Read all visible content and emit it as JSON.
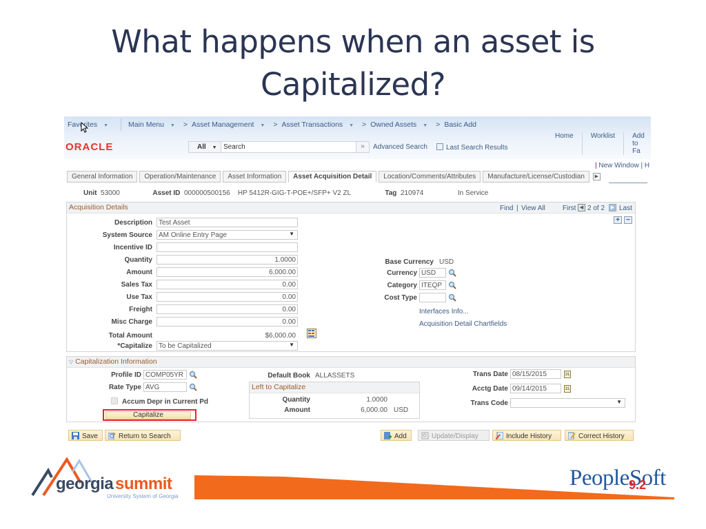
{
  "slide": {
    "title_line1": "What happens when an asset is",
    "title_line2": "Capitalized?"
  },
  "nav": {
    "favorites": "Favorites",
    "main_menu": "Main Menu",
    "breadcrumb": [
      "Asset Management",
      "Asset Transactions",
      "Owned Assets",
      "Basic Add"
    ],
    "sep": ">"
  },
  "header": {
    "logo": "ORACLE",
    "search_scope": "All",
    "search_placeholder": "Search",
    "search_go": "»",
    "advanced_search": "Advanced Search",
    "last_search_results": "Last Search Results",
    "links": [
      "Home",
      "Worklist",
      "Add to Fa"
    ],
    "new_window": "New Window",
    "help_partial": "H"
  },
  "tabs": [
    {
      "label": "General Information",
      "active": false
    },
    {
      "label": "Operation/Maintenance",
      "active": false
    },
    {
      "label": "Asset Information",
      "active": false
    },
    {
      "label": "Asset Acquisition Detail",
      "active": true
    },
    {
      "label": "Location/Comments/Attributes",
      "active": false
    },
    {
      "label": "Manufacture/License/Custodian",
      "active": false
    }
  ],
  "asset_header": {
    "unit_label": "Unit",
    "unit": "53000",
    "asset_id_label": "Asset ID",
    "asset_id": "000000500156",
    "description": "HP 5412R-GIG-T-POE+/SFP+ V2 ZL",
    "tag_label": "Tag",
    "tag": "210974",
    "status": "In Service"
  },
  "acquisition": {
    "title": "Acquisition Details",
    "find": "Find",
    "view_all": "View All",
    "first": "First",
    "page_of": "2 of 2",
    "last": "Last",
    "description_label": "Description",
    "description": "Test Asset",
    "system_source_label": "System Source",
    "system_source": "AM Online Entry Page",
    "incentive_id_label": "Incentive ID",
    "incentive_id": "",
    "quantity_label": "Quantity",
    "quantity": "1.0000",
    "amount_label": "Amount",
    "amount": "6,000.00",
    "sales_tax_label": "Sales Tax",
    "sales_tax": "0.00",
    "use_tax_label": "Use Tax",
    "use_tax": "0.00",
    "freight_label": "Freight",
    "freight": "0.00",
    "misc_charge_label": "Misc Charge",
    "misc_charge": "0.00",
    "total_amount_label": "Total Amount",
    "total_amount": "$6,000.00",
    "capitalize_label": "*Capitalize",
    "capitalize": "To be Capitalized",
    "base_currency_label": "Base Currency",
    "base_currency": "USD",
    "currency_label": "Currency",
    "currency": "USD",
    "category_label": "Category",
    "category": "ITEQP",
    "cost_type_label": "Cost Type",
    "cost_type": "",
    "interfaces_info": "Interfaces Info...",
    "chartfields": "Acquisition Detail Chartfields"
  },
  "capitalization": {
    "title": "Capitalization Information",
    "profile_id_label": "Profile ID",
    "profile_id": "COMP05YR",
    "rate_type_label": "Rate Type",
    "rate_type": "AVG",
    "accum_depr_label": "Accum Depr in Current Pd",
    "capitalize_button": "Capitalize",
    "default_book_label": "Default Book",
    "default_book": "ALLASSETS",
    "left_title": "Left to Capitalize",
    "left_quantity_label": "Quantity",
    "left_quantity": "1.0000",
    "left_amount_label": "Amount",
    "left_amount": "6,000.00",
    "left_currency": "USD",
    "trans_date_label": "Trans Date",
    "trans_date": "08/15/2015",
    "acctg_date_label": "Acctg Date",
    "acctg_date": "09/14/2015",
    "trans_code_label": "Trans Code",
    "trans_code": ""
  },
  "toolbar": {
    "save": "Save",
    "return_to_search": "Return to Search",
    "add": "Add",
    "update_display": "Update/Display",
    "include_history": "Include History",
    "correct_history": "Correct History"
  },
  "footer": {
    "georgia": "georgia",
    "summit": "summit",
    "usg": "University System of Georgia",
    "peoplesoft": "PeopleSoft",
    "version": "9.2"
  }
}
